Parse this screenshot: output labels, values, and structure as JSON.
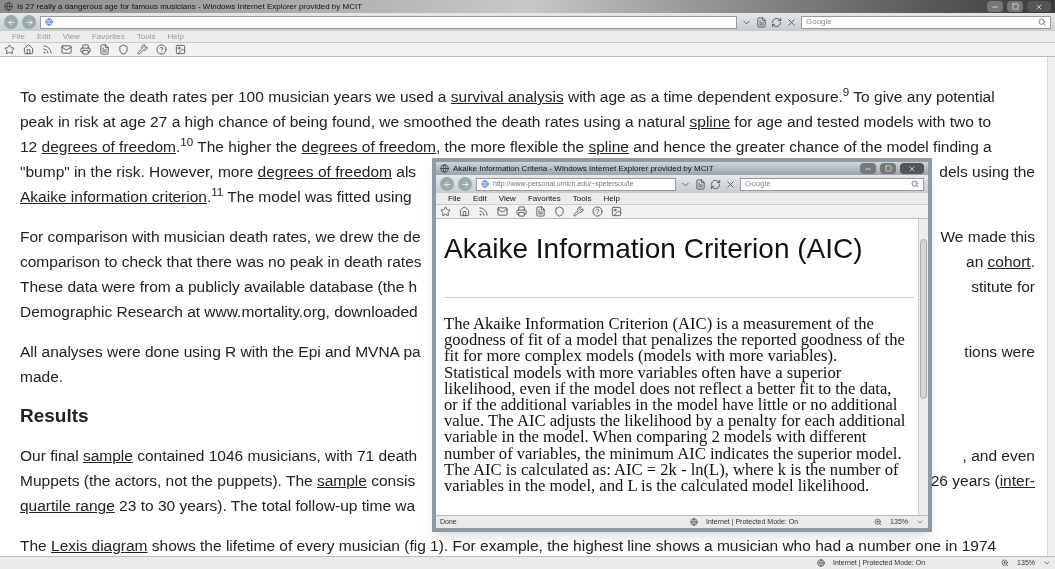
{
  "main_window": {
    "title": "Is 27 really a dangerous age for famous musicians - Windows Internet Explorer provided by MCIT",
    "active": false,
    "search_placeholder": "Google",
    "menu": [
      {
        "label": "File"
      },
      {
        "label": "Edit"
      },
      {
        "label": "View"
      },
      {
        "label": "Favorites"
      },
      {
        "label": "Tools"
      },
      {
        "label": "Help"
      }
    ],
    "page": [
      {
        "kind": "paragraph",
        "lines": [
          {
            "left": [
              {
                "kind": "text",
                "text": "To estimate the death rates per 100 musician years we used a "
              },
              {
                "kind": "link",
                "text": "survival analysis"
              },
              {
                "kind": "text",
                "text": " with age as a time dependent exposure.$^{9}$  To give any potential"
              }
            ]
          },
          {
            "left": [
              {
                "kind": "text",
                "text": "peak in risk at age 27 a high chance of being found, we smoothed the death rates using a natural "
              },
              {
                "kind": "link",
                "text": "spline"
              },
              {
                "kind": "text",
                "text": " for age and tested models with two to"
              }
            ]
          },
          {
            "left": [
              {
                "kind": "text",
                "text": "12 "
              },
              {
                "kind": "link",
                "text": "degrees of freedom"
              },
              {
                "kind": "text",
                "text": ".$^{10}$  The higher the "
              },
              {
                "kind": "link",
                "text": "degrees of freedom"
              },
              {
                "kind": "text",
                "text": ", the more flexible the "
              },
              {
                "kind": "link",
                "text": "spline"
              },
              {
                "kind": "text",
                "text": " and hence the greater chance of the model finding a"
              }
            ]
          },
          {
            "left": [
              {
                "kind": "text",
                "text": "\"bump\" in the risk. However, more "
              },
              {
                "kind": "link",
                "text": "degrees of freedom"
              },
              {
                "kind": "text",
                "text": " als"
              }
            ],
            "right": [
              {
                "kind": "text",
                "text": "dels using the"
              }
            ]
          },
          {
            "left": [
              {
                "kind": "link",
                "text": "Akaike information criterion"
              },
              {
                "kind": "text",
                "text": ".$^{11}$ The model was fitted using"
              }
            ]
          }
        ]
      },
      {
        "kind": "paragraph",
        "lines": [
          {
            "left": [
              {
                "kind": "text",
                "text": "For comparison with musician death rates, we drew the de"
              }
            ],
            "right": [
              {
                "kind": "text",
                "text": "We made this"
              }
            ]
          },
          {
            "left": [
              {
                "kind": "text",
                "text": "comparison to check that there was no peak in death rates"
              }
            ],
            "right": [
              {
                "kind": "text",
                "text": "an "
              },
              {
                "kind": "link",
                "text": "cohort"
              },
              {
                "kind": "text",
                "text": "."
              }
            ]
          },
          {
            "left": [
              {
                "kind": "text",
                "text": "These data were from a publicly available database (the h"
              }
            ],
            "right": [
              {
                "kind": "text",
                "text": "stitute for"
              }
            ]
          },
          {
            "left": [
              {
                "kind": "text",
                "text": "Demographic Research at www.mortality.org, downloaded"
              }
            ]
          }
        ]
      },
      {
        "kind": "paragraph",
        "lines": [
          {
            "left": [
              {
                "kind": "text",
                "text": "All analyses were done using R with the Epi and MVNA pa"
              }
            ],
            "right": [
              {
                "kind": "text",
                "text": "tions were"
              }
            ]
          },
          {
            "left": [
              {
                "kind": "text",
                "text": "made."
              }
            ]
          }
        ]
      },
      {
        "kind": "heading",
        "text": "Results"
      },
      {
        "kind": "paragraph",
        "lines": [
          {
            "left": [
              {
                "kind": "text",
                "text": "Our final "
              },
              {
                "kind": "link",
                "text": "sample"
              },
              {
                "kind": "text",
                "text": " contained 1046 musicians, with 71 death"
              }
            ],
            "right": [
              {
                "kind": "text",
                "text": ", and even"
              }
            ]
          },
          {
            "left": [
              {
                "kind": "text",
                "text": "Muppets (the actors, not the puppets). The "
              },
              {
                "kind": "link",
                "text": "sample"
              },
              {
                "kind": "text",
                "text": " consis"
              }
            ],
            "right": [
              {
                "kind": "text",
                "text": "26 years ("
              },
              {
                "kind": "link",
                "text": "inter-"
              }
            ]
          },
          {
            "left": [
              {
                "kind": "link",
                "text": "quartile range"
              },
              {
                "kind": "text",
                "text": " 23 to 30 years). The total follow-up time wa"
              }
            ]
          }
        ]
      },
      {
        "kind": "paragraph",
        "lines": [
          {
            "left": [
              {
                "kind": "text",
                "text": "The "
              },
              {
                "kind": "link",
                "text": "Lexis diagram"
              },
              {
                "kind": "text",
                "text": " shows the lifetime of every musician (fig 1). For example, the highest line shows a musician who had a number one in 1974"
              }
            ]
          }
        ]
      }
    ],
    "status_bar": {
      "zone": "Internet | Protected Mode: On",
      "zoom": "135%"
    }
  },
  "popup_window": {
    "title": "Akaike Information Criteria - Windows Internet Explorer provided by MCIT",
    "active": true,
    "address": "http://www-personal.umich.edu/~spetersou/te",
    "search_placeholder": "Google",
    "menu": [
      {
        "label": "File"
      },
      {
        "label": "Edit"
      },
      {
        "label": "View"
      },
      {
        "label": "Favorites"
      },
      {
        "label": "Tools"
      },
      {
        "label": "Help"
      }
    ],
    "heading": "Akaike Information Criterion (AIC)",
    "body": "The Akaike Information Criterion (AIC) is a measurement of the goodness of fit of a model that penalizes the reported goodness of the fit for more complex models (models with more variables). Statistical models with more variables often have a superior likelihood, even if the model does not reflect a better fit to the data, or if the additional variables in the model have little or no additional value. The AIC adjusts the likelihood by a penalty for each additional variable in the model. When comparing 2 models with different number of variables, the minimum AIC indicates the superior model. The AIC is calculated as: AIC = 2k - ln(L), where k is the number of variables in the model, and L is the calculated model likelihood.",
    "status_bar": {
      "status": "Done",
      "zone": "Internet | Protected Mode: On",
      "zoom": "135%"
    }
  }
}
